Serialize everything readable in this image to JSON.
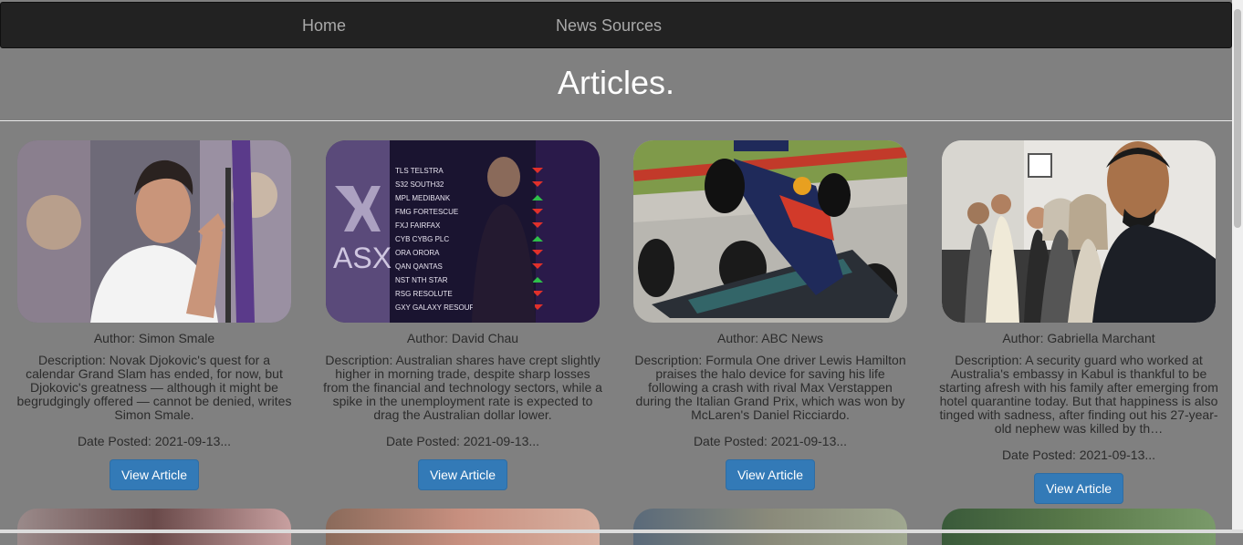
{
  "nav": {
    "home": "Home",
    "sources": "News Sources"
  },
  "page": {
    "title": "Articles."
  },
  "articles": [
    {
      "author": "Author: Simon Smale",
      "description": "Description: Novak Djokovic's quest for a calendar Grand Slam has ended, for now, but Djokovic's greatness — although it might be begrudgingly offered — cannot be denied, writes Simon Smale.",
      "date": "Date Posted: 2021-09-13...",
      "button": "View Article"
    },
    {
      "author": "Author: David Chau",
      "description": "Description: Australian shares have crept slightly higher in morning trade, despite sharp losses from the financial and technology sectors, while a spike in the unemployment rate is expected to drag the Australian dollar lower.",
      "date": "Date Posted: 2021-09-13...",
      "button": "View Article"
    },
    {
      "author": "Author: ABC News",
      "description": "Description: Formula One driver Lewis Hamilton praises the halo device for saving his life following a crash with rival Max Verstappen during the Italian Grand Prix, which was won by McLaren's Daniel Ricciardo.",
      "date": "Date Posted: 2021-09-13...",
      "button": "View Article"
    },
    {
      "author": "Author: Gabriella Marchant",
      "description": "Description: A security guard who worked at Australia's embassy in Kabul is thankful to be starting afresh with his family after emerging from hotel quarantine today. But that happiness is also tinged with sadness, after finding out his 27-year-old nephew was killed by th…",
      "date": "Date Posted: 2021-09-13...",
      "button": "View Article"
    }
  ],
  "ticker": {
    "sign": "ASX",
    "rows": [
      "TLS TELSTRA",
      "S32 SOUTH32",
      "MPL MEDIBANK",
      "FMG FORTESCUE",
      "FXJ FAIRFAX",
      "CYB CYBG PLC",
      "ORA ORORA",
      "QAN QANTAS",
      "NST NTH STAR",
      "RSG RESOLUTE",
      "GXY GALAXY RESOURCES"
    ]
  }
}
